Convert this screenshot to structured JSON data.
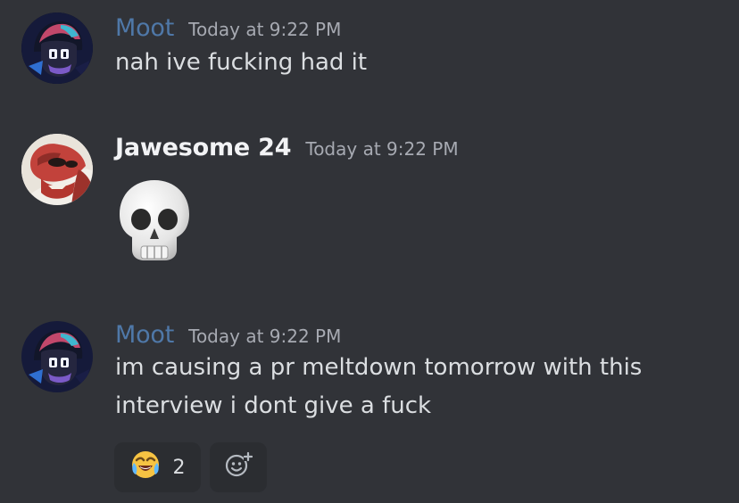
{
  "messages": [
    {
      "username": "Moot",
      "timestamp": "Today at 9:22 PM",
      "lines": [
        "nah ive fucking had it"
      ]
    },
    {
      "username": "Jawesome 24",
      "timestamp": "Today at 9:22 PM",
      "emoji": "skull-emoji"
    },
    {
      "username": "Moot",
      "timestamp": "Today at 9:22 PM",
      "lines": [
        "im causing a pr meltdown tomorrow with this",
        "interview i dont give a fuck"
      ],
      "reactions": [
        {
          "emoji": "joy-emoji",
          "count": "2"
        },
        {
          "icon": "add-reaction-icon"
        }
      ]
    }
  ],
  "colors": {
    "background": "#313338",
    "moot_name": "#4f78a8",
    "jawesome_name": "#f2f3f5",
    "timestamp": "#a7aab2",
    "message_text": "#dbdee1",
    "reaction_bg": "#2b2d31"
  }
}
